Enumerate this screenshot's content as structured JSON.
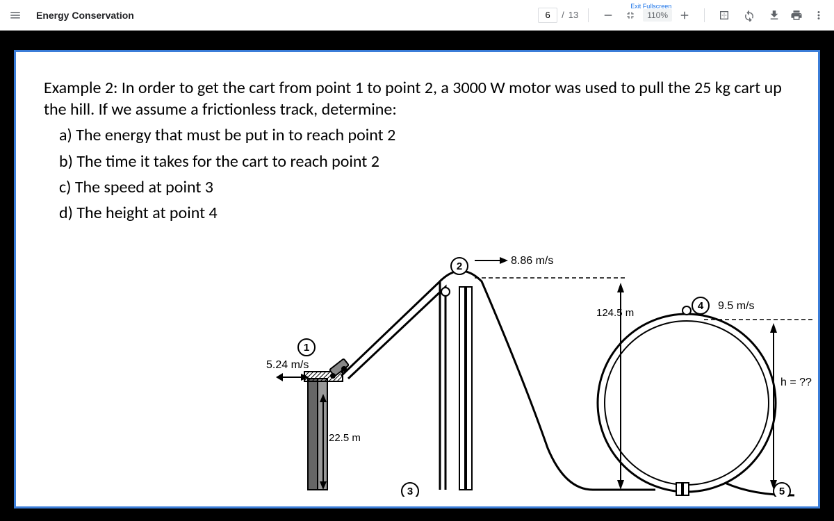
{
  "toolbar": {
    "title": "Energy Conservation",
    "page_current": "6",
    "page_total": "13",
    "page_sep": "/",
    "zoom": "110%",
    "exit_fullscreen": "Exit Fullscreen"
  },
  "problem": {
    "intro": "Example 2: In order to get the cart from point 1 to point 2, a 3000 W motor was used to pull the 25 kg cart up the hill. If we assume a frictionless track, determine:",
    "a": "a)   The energy that must be put in to reach point 2",
    "b": "b)   The time it takes for the cart to reach point 2",
    "c": "c)   The speed at point 3",
    "d": "d)   The height at point 4"
  },
  "diagram": {
    "point1": "1",
    "point2": "2",
    "point3": "3",
    "point4": "4",
    "point5": "5",
    "v1": "5.24 m/s",
    "h1": "22.5 m",
    "v2": "8.86 m/s",
    "h2": "124.5 m",
    "v4": "9.5 m/s",
    "h4": "h = ??"
  }
}
